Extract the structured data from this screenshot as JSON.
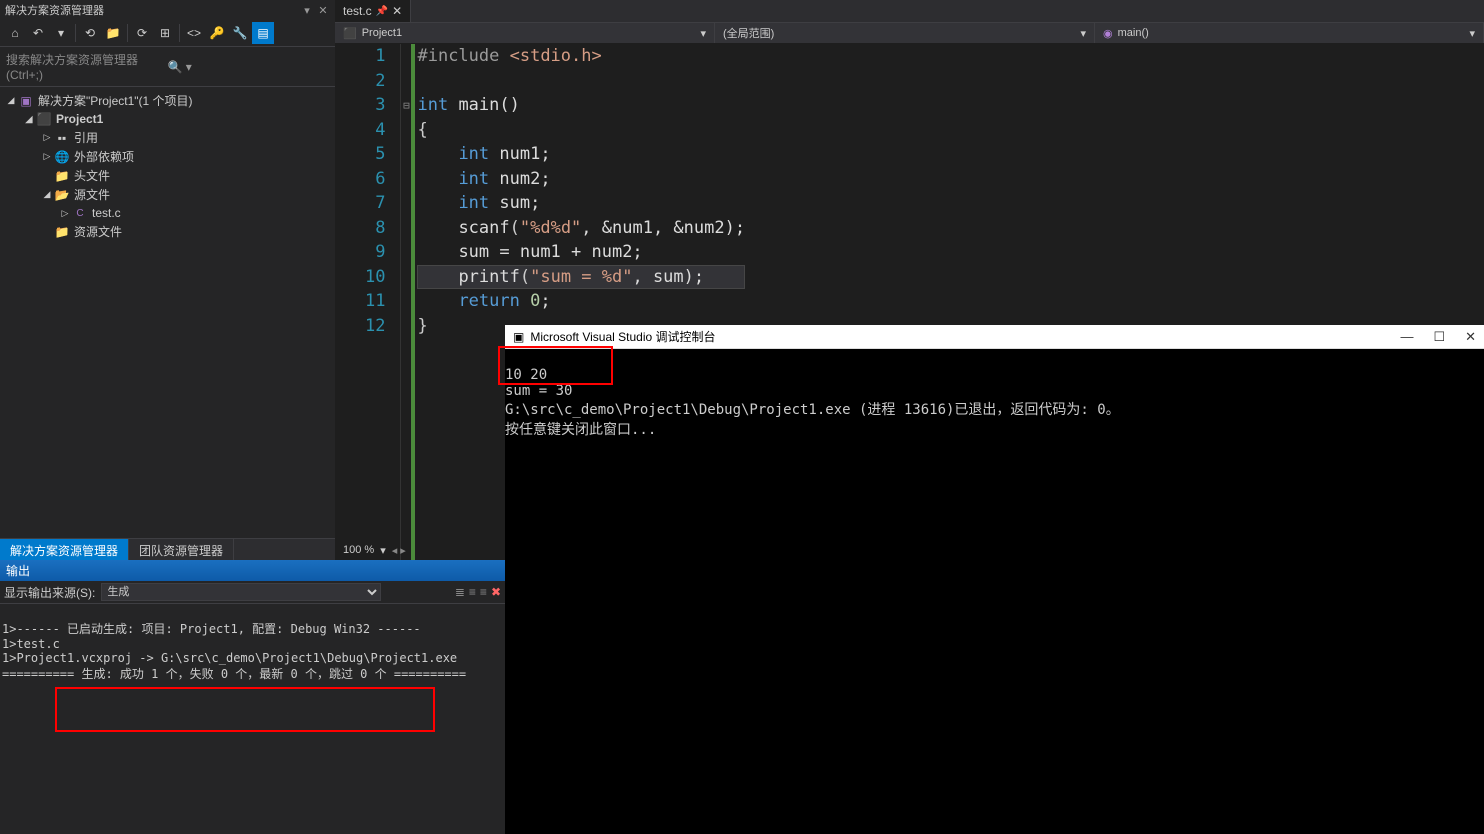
{
  "explorer": {
    "title": "解决方案资源管理器",
    "search_placeholder": "搜索解决方案资源管理器(Ctrl+;)",
    "solution": "解决方案\"Project1\"(1 个项目)",
    "project": "Project1",
    "refs": "引用",
    "external": "外部依赖项",
    "headers": "头文件",
    "sources": "源文件",
    "source_file": "test.c",
    "resources": "资源文件",
    "tab_active": "解决方案资源管理器",
    "tab_team": "团队资源管理器"
  },
  "tabs": {
    "file": "test.c"
  },
  "nav": {
    "project": "Project1",
    "scope": "(全局范围)",
    "func": "main()"
  },
  "zoom": "100 %",
  "code": {
    "lines": [
      {
        "n": 1
      },
      {
        "n": 2
      },
      {
        "n": 3
      },
      {
        "n": 4
      },
      {
        "n": 5
      },
      {
        "n": 6
      },
      {
        "n": 7
      },
      {
        "n": 8
      },
      {
        "n": 9
      },
      {
        "n": 10
      },
      {
        "n": 11
      },
      {
        "n": 12
      }
    ],
    "l1a": "#include ",
    "l1b": "<stdio.h>",
    "l3a": "int",
    "l3b": " main()",
    "l4": "{",
    "l5a": "int",
    "l5b": " num1;",
    "l6a": "int",
    "l6b": " num2;",
    "l7a": "int",
    "l7b": " sum;",
    "l8a": "scanf",
    "l8b": "(",
    "l8c": "\"%d%d\"",
    "l8d": ", &num1, &num2);",
    "l9": "sum = num1 + num2;",
    "l10a": "printf",
    "l10b": "(",
    "l10c": "\"sum = %d\"",
    "l10d": ", sum);",
    "l11a": "return ",
    "l11b": "0",
    "l11c": ";",
    "l12": "}"
  },
  "output": {
    "title": "输出",
    "source_label": "显示输出来源(S):",
    "source_value": "生成",
    "line1": "1>------ 已启动生成: 项目: Project1, 配置: Debug Win32 ------",
    "line2": "1>test.c",
    "line3": "1>Project1.vcxproj -> G:\\src\\c_demo\\Project1\\Debug\\Project1.exe",
    "line4": "========== 生成: 成功 1 个，失败 0 个，最新 0 个，跳过 0 个 =========="
  },
  "console": {
    "title": "Microsoft Visual Studio 调试控制台",
    "input": "10 20",
    "result": "sum = 30",
    "exit": "G:\\src\\c_demo\\Project1\\Debug\\Project1.exe (进程 13616)已退出，返回代码为: 0。",
    "prompt": "按任意键关闭此窗口..."
  }
}
